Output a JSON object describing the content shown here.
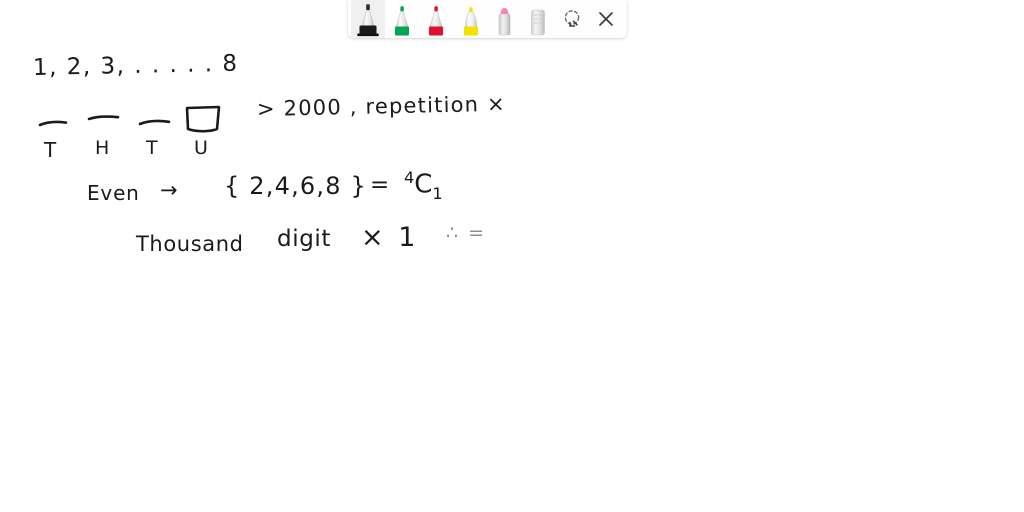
{
  "app": {
    "title": "Whiteboard Ink Annotation",
    "canvas_background": "#ffffff",
    "ink_color": "#1b1b1b"
  },
  "toolbar": {
    "position": "top-center",
    "background": "#fefefe",
    "selected_tool": "black-marker",
    "tools": [
      {
        "id": "black-marker",
        "label": "Black marker",
        "icon": "marker-icon",
        "color": "#1a1a1a",
        "selected": true
      },
      {
        "id": "green-marker",
        "label": "Green marker",
        "icon": "marker-icon",
        "color": "#00a550",
        "selected": false
      },
      {
        "id": "red-marker",
        "label": "Red marker",
        "icon": "marker-icon",
        "color": "#e01030",
        "selected": false
      },
      {
        "id": "yellow-marker",
        "label": "Yellow marker",
        "icon": "marker-icon",
        "color": "#f5e000",
        "selected": false
      },
      {
        "id": "pink-marker",
        "label": "Pink marker",
        "icon": "marker-icon",
        "color": "#f585b0",
        "selected": false
      },
      {
        "id": "eraser",
        "label": "Eraser",
        "icon": "eraser-icon",
        "color": "#d8d8d8",
        "selected": false
      }
    ],
    "actions": [
      {
        "id": "lasso-select",
        "label": "Lasso select",
        "icon": "lasso-select-icon"
      },
      {
        "id": "close",
        "label": "Close",
        "icon": "close-icon"
      }
    ]
  },
  "notes": {
    "line1": {
      "text": "1, 2, 3, . . . . . 8"
    },
    "line2": {
      "place_values": [
        {
          "label": "T",
          "kind": "blank"
        },
        {
          "label": "H",
          "kind": "blank"
        },
        {
          "label": "T",
          "kind": "blank"
        },
        {
          "label": "U",
          "kind": "box"
        }
      ],
      "condition": "> 2000 , repetition  ×"
    },
    "line3": {
      "label": "Even",
      "arrow": "→",
      "set": "{ 2,4,6,8 }",
      "equals": "=",
      "result_base": "4",
      "result_symbol": "C",
      "result_index": "1"
    },
    "line4": {
      "text_a": "Thousand",
      "text_b": "digit",
      "multiply": "× 1",
      "trailing": "∴ ="
    }
  }
}
